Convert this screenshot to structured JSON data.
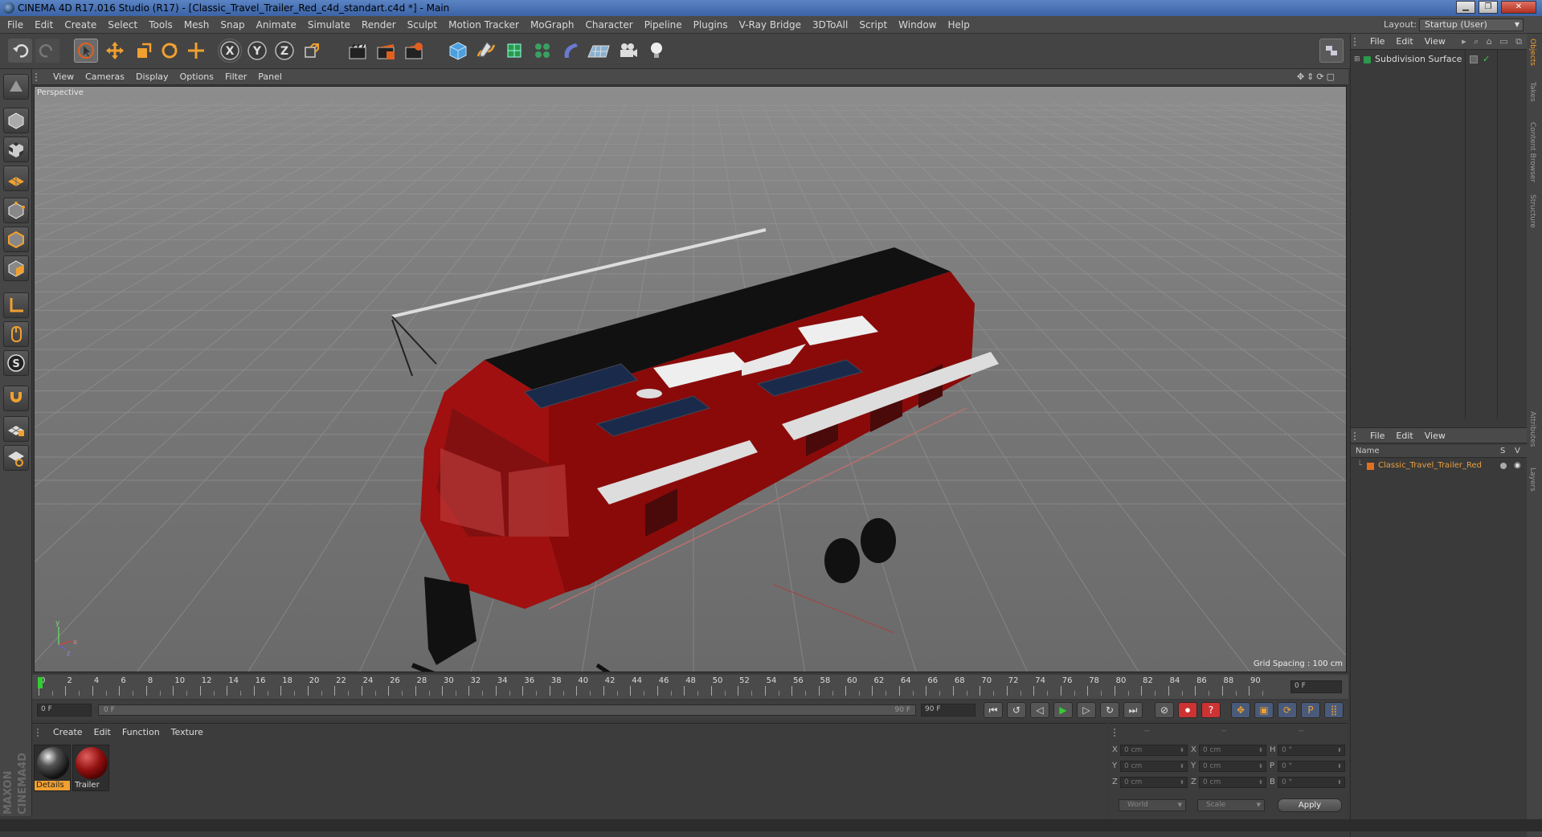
{
  "window": {
    "title": "CINEMA 4D R17.016 Studio (R17) - [Classic_Travel_Trailer_Red_c4d_standart.c4d *] - Main",
    "layout_label": "Layout:",
    "layout_value": "Startup (User)"
  },
  "menubar": [
    "File",
    "Edit",
    "Create",
    "Select",
    "Tools",
    "Mesh",
    "Snap",
    "Animate",
    "Simulate",
    "Render",
    "Sculpt",
    "Motion Tracker",
    "MoGraph",
    "Character",
    "Pipeline",
    "Plugins",
    "V-Ray Bridge",
    "3DToAll",
    "Script",
    "Window",
    "Help"
  ],
  "viewport": {
    "menu": [
      "View",
      "Cameras",
      "Display",
      "Options",
      "Filter",
      "Panel"
    ],
    "label": "Perspective",
    "grid_spacing": "Grid Spacing : 100 cm"
  },
  "timeline": {
    "ticks": [
      "0",
      "2",
      "4",
      "6",
      "8",
      "10",
      "12",
      "14",
      "16",
      "18",
      "20",
      "22",
      "24",
      "26",
      "28",
      "30",
      "32",
      "34",
      "36",
      "38",
      "40",
      "42",
      "44",
      "46",
      "48",
      "50",
      "52",
      "54",
      "56",
      "58",
      "60",
      "62",
      "64",
      "66",
      "68",
      "70",
      "72",
      "74",
      "76",
      "78",
      "80",
      "82",
      "84",
      "86",
      "88",
      "90"
    ],
    "current_frame": "0 F",
    "start_field": "0 F",
    "range_start": "0 F",
    "range_end": "90 F",
    "end_field": "90 F"
  },
  "materials": {
    "menu": [
      "Create",
      "Edit",
      "Function",
      "Texture"
    ],
    "items": [
      {
        "name": "Details",
        "highlight": true
      },
      {
        "name": "Trailer",
        "highlight": false
      }
    ],
    "brand": "MAXON CINEMA4D"
  },
  "coordinates": {
    "header": [
      "--",
      "--",
      "--"
    ],
    "rows": [
      {
        "a": "X",
        "av": "0 cm",
        "b": "X",
        "bv": "0 cm",
        "c": "H",
        "cv": "0 °"
      },
      {
        "a": "Y",
        "av": "0 cm",
        "b": "Y",
        "bv": "0 cm",
        "c": "P",
        "cv": "0 °"
      },
      {
        "a": "Z",
        "av": "0 cm",
        "b": "Z",
        "bv": "0 cm",
        "c": "B",
        "cv": "0 °"
      }
    ],
    "world": "World",
    "scale": "Scale",
    "apply": "Apply"
  },
  "objects_panel": {
    "menu": [
      "File",
      "Edit",
      "View"
    ],
    "items": [
      "Subdivision Surface"
    ]
  },
  "layers_panel": {
    "menu": [
      "File",
      "Edit",
      "View"
    ],
    "col_name": "Name",
    "col_s": "S",
    "col_v": "V",
    "items": [
      "Classic_Travel_Trailer_Red"
    ]
  },
  "side_tabs": [
    "Objects",
    "Takes",
    "Content Browser",
    "Structure",
    "Attributes",
    "Layers"
  ],
  "colors": {
    "accent_orange": "#f0a030",
    "trailer_red": "#a01010",
    "layer_text": "#e8a040"
  }
}
